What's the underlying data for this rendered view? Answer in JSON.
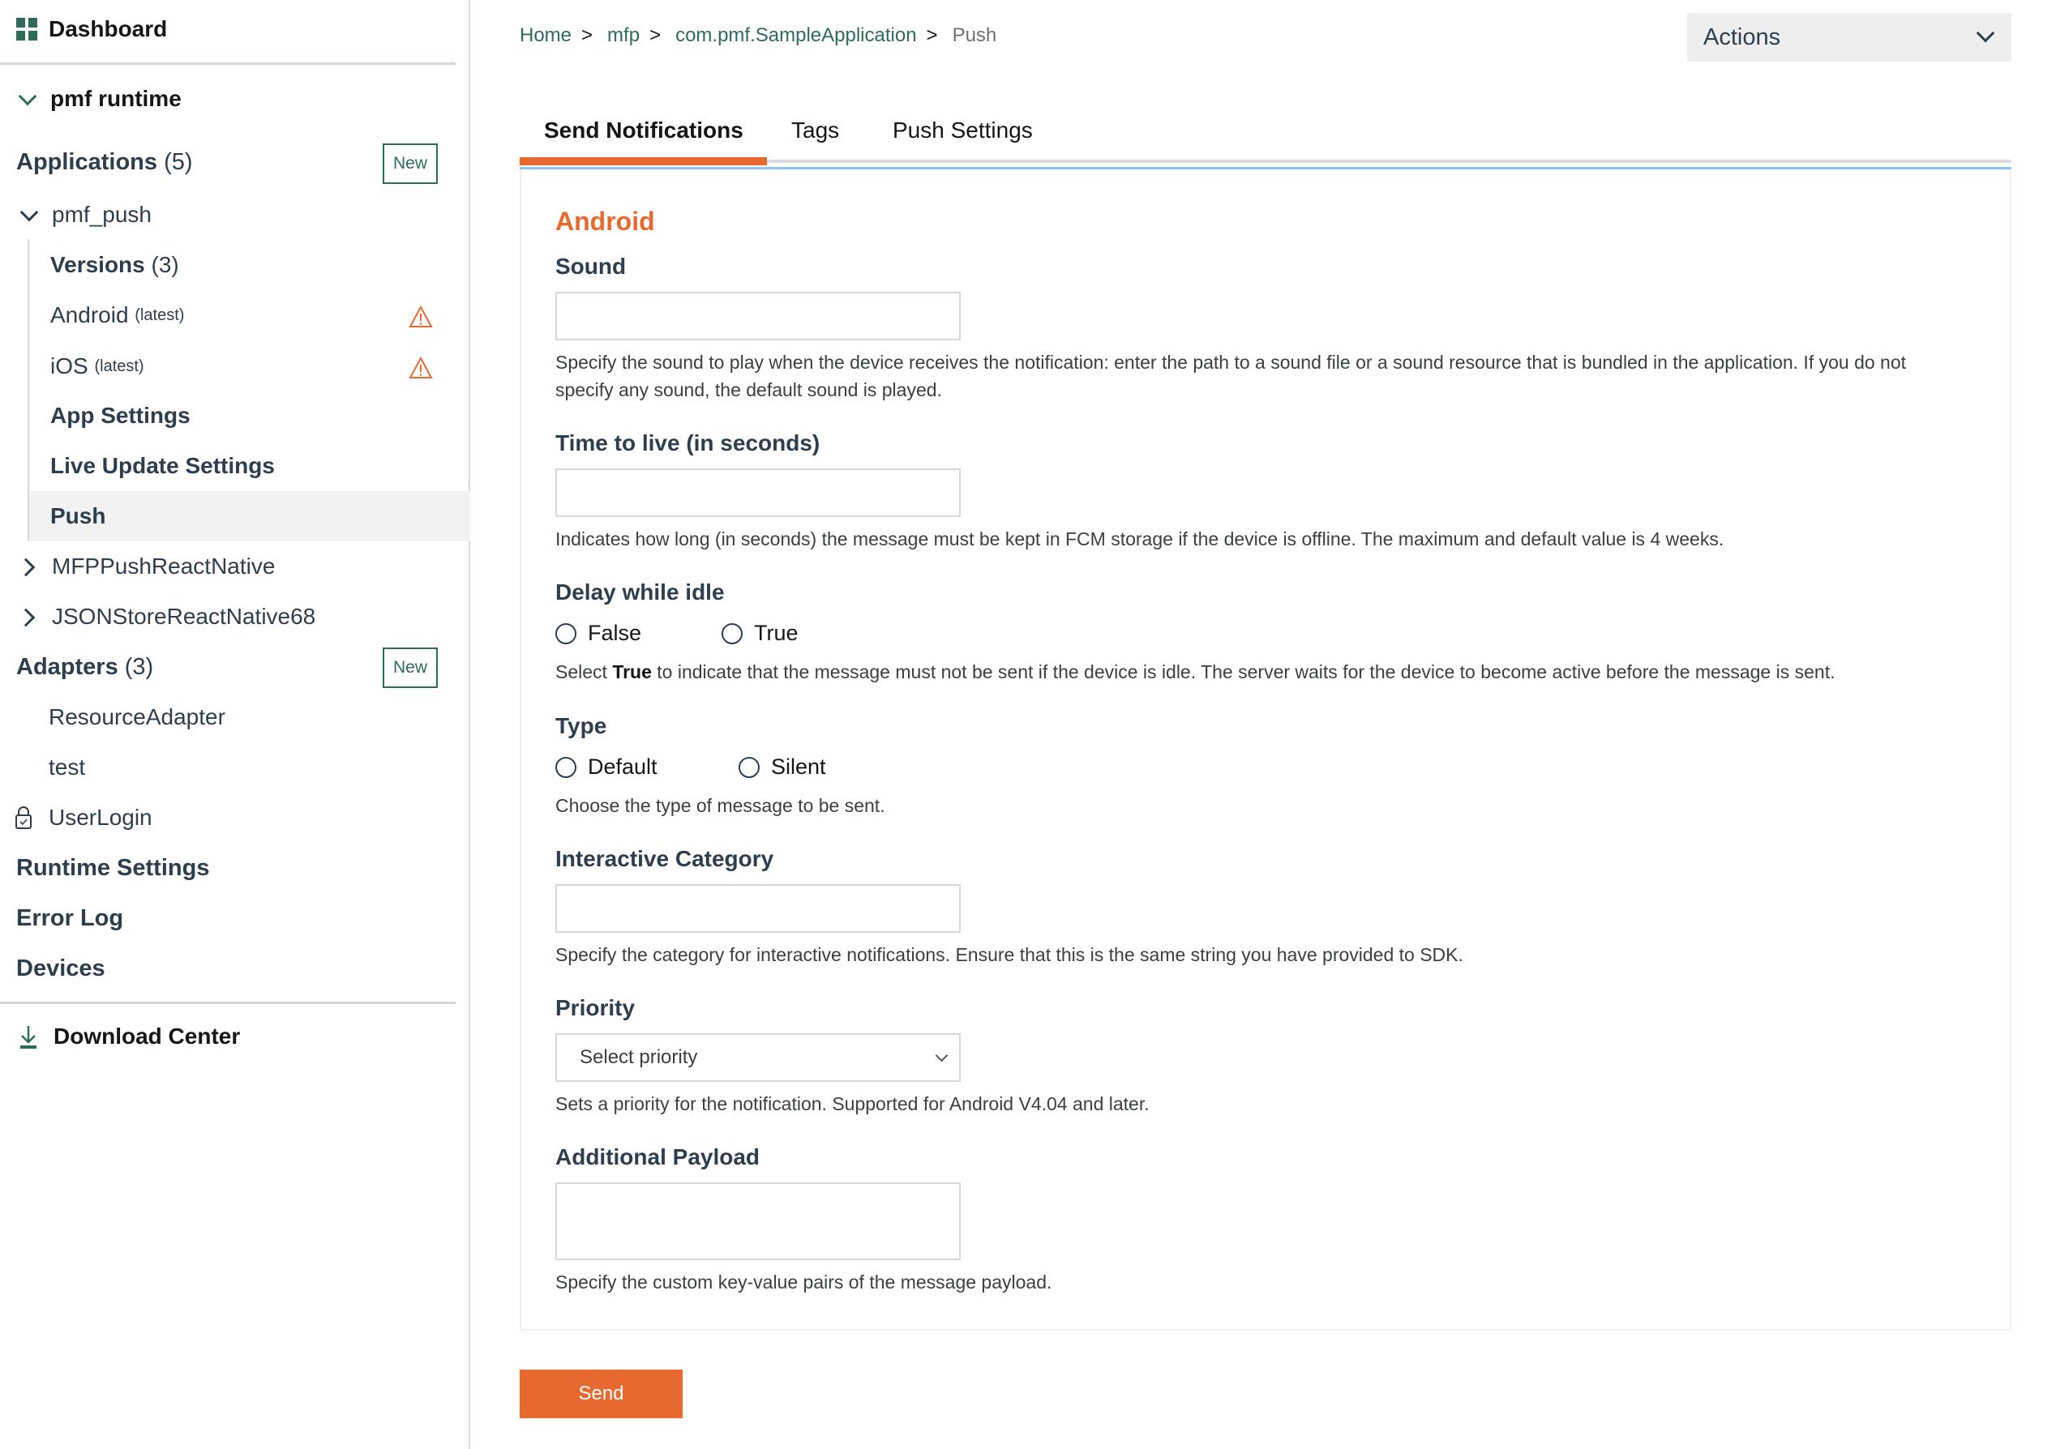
{
  "sidebar": {
    "dashboard": "Dashboard",
    "runtime": "pmf runtime",
    "applications": {
      "label": "Applications",
      "count": "(5)",
      "new_label": "New"
    },
    "app_expanded": "pmf_push",
    "app_children": {
      "versions": {
        "label": "Versions",
        "count": "(3)"
      },
      "android": {
        "label": "Android",
        "tag": "(latest)"
      },
      "ios": {
        "label": "iOS",
        "tag": "(latest)"
      },
      "app_settings": "App Settings",
      "live_update": "Live Update Settings",
      "push": "Push"
    },
    "other_apps": [
      "MFPPushReactNative",
      "JSONStoreReactNative68"
    ],
    "adapters": {
      "label": "Adapters",
      "count": "(3)",
      "new_label": "New"
    },
    "adapter_items": [
      "ResourceAdapter",
      "test",
      "UserLogin"
    ],
    "runtime_settings": "Runtime Settings",
    "error_log": "Error Log",
    "devices": "Devices",
    "download_center": "Download Center"
  },
  "breadcrumb": {
    "items": [
      "Home",
      "mfp",
      "com.pmf.SampleApplication"
    ],
    "separator": ">",
    "current": "Push"
  },
  "actions": {
    "label": "Actions"
  },
  "tabs": [
    {
      "label": "Send Notifications",
      "active": true
    },
    {
      "label": "Tags",
      "active": false
    },
    {
      "label": "Push Settings",
      "active": false
    }
  ],
  "colors": {
    "accent": "#e8692f",
    "brand_green": "#2e6b5b",
    "text_dark": "#2d3e4f",
    "tab_divider": "#8cc3ef"
  },
  "form": {
    "section_title": "Android",
    "sound": {
      "label": "Sound",
      "value": "",
      "help": "Specify the sound to play when the device receives the notification: enter the path to a sound file or a sound resource that is bundled in the application. If you do not specify any sound, the default sound is played."
    },
    "ttl": {
      "label": "Time to live (in seconds)",
      "value": "",
      "help": "Indicates how long (in seconds) the message must be kept in FCM storage if the device is offline. The maximum and default value is 4 weeks."
    },
    "delay": {
      "label": "Delay while idle",
      "options": [
        "False",
        "True"
      ],
      "help_prefix": "Select ",
      "help_bold": "True",
      "help_suffix": " to indicate that the message must not be sent if the device is idle. The server waits for the device to become active before the message is sent."
    },
    "type": {
      "label": "Type",
      "options": [
        "Default",
        "Silent"
      ],
      "help": "Choose the type of message to be sent."
    },
    "interactive": {
      "label": "Interactive Category",
      "value": "",
      "help": "Specify the category for interactive notifications. Ensure that this is the same string you have provided to SDK."
    },
    "priority": {
      "label": "Priority",
      "selected": "Select priority",
      "help": "Sets a priority for the notification. Supported for Android V4.04 and later."
    },
    "payload": {
      "label": "Additional Payload",
      "value": "",
      "help": "Specify the custom key-value pairs of the message payload."
    }
  },
  "send_label": "Send"
}
